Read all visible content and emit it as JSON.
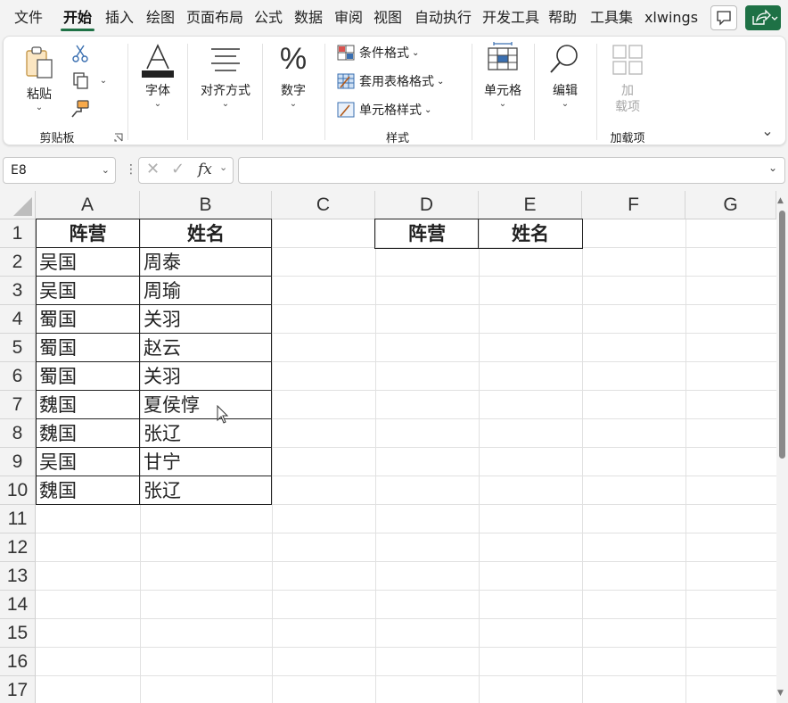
{
  "ribbon_tabs": [
    "文件",
    "开始",
    "插入",
    "绘图",
    "页面布局",
    "公式",
    "数据",
    "审阅",
    "视图",
    "自动执行",
    "开发工具",
    "帮助",
    "工具集",
    "xlwings"
  ],
  "active_tab": "开始",
  "clipboard": {
    "paste_label": "粘贴",
    "group_label": "剪贴板"
  },
  "font": {
    "label": "字体"
  },
  "alignment": {
    "label": "对齐方式"
  },
  "number": {
    "label": "数字"
  },
  "styles": {
    "conditional_format": "条件格式",
    "format_as_table": "套用表格格式",
    "cell_styles": "单元格样式",
    "group_label": "样式"
  },
  "cells": {
    "label": "单元格"
  },
  "editing": {
    "label": "编辑"
  },
  "addins": {
    "button_line1": "加",
    "button_line2": "载项",
    "group_label": "加载项"
  },
  "formula_bar": {
    "name_box": "E8",
    "fx": "fx",
    "content": ""
  },
  "columns": [
    "A",
    "B",
    "C",
    "D",
    "E",
    "F",
    "G"
  ],
  "rows": [
    "1",
    "2",
    "3",
    "4",
    "5",
    "6",
    "7",
    "8",
    "9",
    "10",
    "11",
    "12",
    "13",
    "14",
    "15",
    "16",
    "17"
  ],
  "table": {
    "headers": [
      "阵营",
      "姓名"
    ],
    "rows": [
      [
        "吴国",
        "周泰"
      ],
      [
        "吴国",
        "周瑜"
      ],
      [
        "蜀国",
        "关羽"
      ],
      [
        "蜀国",
        "赵云"
      ],
      [
        "蜀国",
        "关羽"
      ],
      [
        "魏国",
        "夏侯惇"
      ],
      [
        "魏国",
        "张辽"
      ],
      [
        "吴国",
        "甘宁"
      ],
      [
        "魏国",
        "张辽"
      ]
    ]
  },
  "output_headers": [
    "阵营",
    "姓名"
  ],
  "colors": {
    "accent": "#1e7145",
    "grid": "#e1e1e1",
    "border": "#222222"
  }
}
